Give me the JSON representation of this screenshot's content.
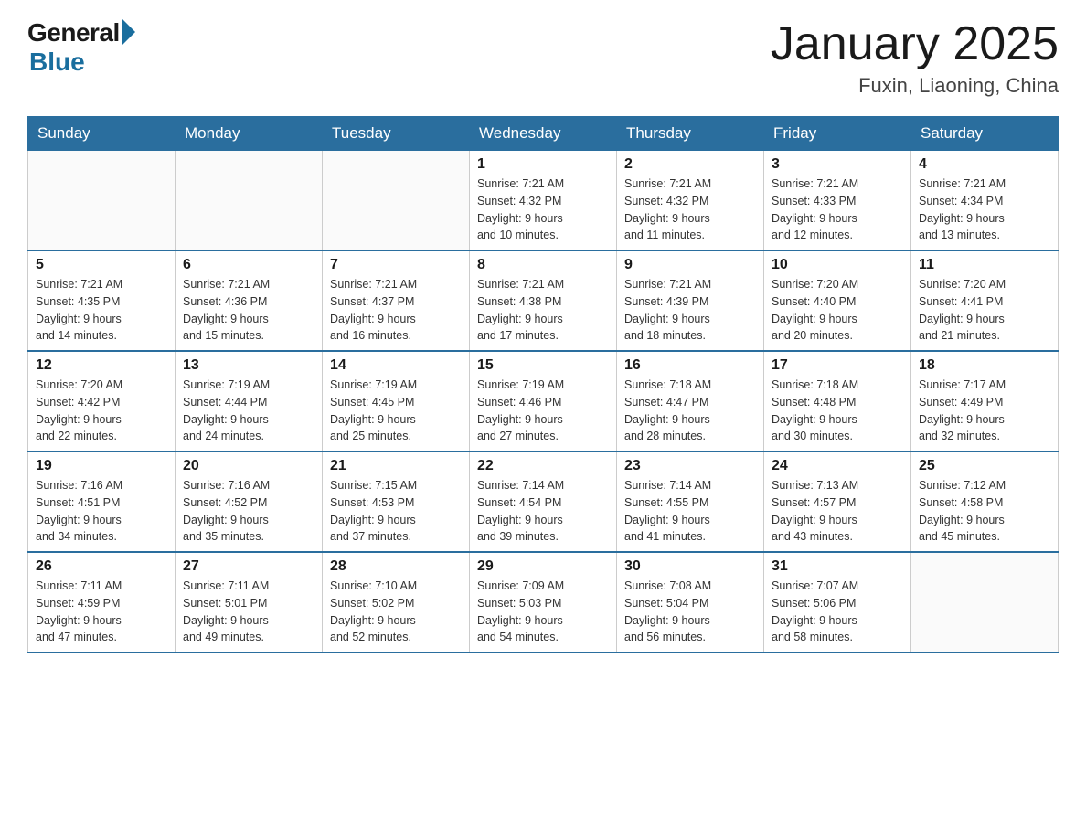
{
  "header": {
    "logo_general": "General",
    "logo_blue": "Blue",
    "title": "January 2025",
    "subtitle": "Fuxin, Liaoning, China"
  },
  "days_of_week": [
    "Sunday",
    "Monday",
    "Tuesday",
    "Wednesday",
    "Thursday",
    "Friday",
    "Saturday"
  ],
  "weeks": [
    [
      {
        "day": "",
        "info": ""
      },
      {
        "day": "",
        "info": ""
      },
      {
        "day": "",
        "info": ""
      },
      {
        "day": "1",
        "info": "Sunrise: 7:21 AM\nSunset: 4:32 PM\nDaylight: 9 hours\nand 10 minutes."
      },
      {
        "day": "2",
        "info": "Sunrise: 7:21 AM\nSunset: 4:32 PM\nDaylight: 9 hours\nand 11 minutes."
      },
      {
        "day": "3",
        "info": "Sunrise: 7:21 AM\nSunset: 4:33 PM\nDaylight: 9 hours\nand 12 minutes."
      },
      {
        "day": "4",
        "info": "Sunrise: 7:21 AM\nSunset: 4:34 PM\nDaylight: 9 hours\nand 13 minutes."
      }
    ],
    [
      {
        "day": "5",
        "info": "Sunrise: 7:21 AM\nSunset: 4:35 PM\nDaylight: 9 hours\nand 14 minutes."
      },
      {
        "day": "6",
        "info": "Sunrise: 7:21 AM\nSunset: 4:36 PM\nDaylight: 9 hours\nand 15 minutes."
      },
      {
        "day": "7",
        "info": "Sunrise: 7:21 AM\nSunset: 4:37 PM\nDaylight: 9 hours\nand 16 minutes."
      },
      {
        "day": "8",
        "info": "Sunrise: 7:21 AM\nSunset: 4:38 PM\nDaylight: 9 hours\nand 17 minutes."
      },
      {
        "day": "9",
        "info": "Sunrise: 7:21 AM\nSunset: 4:39 PM\nDaylight: 9 hours\nand 18 minutes."
      },
      {
        "day": "10",
        "info": "Sunrise: 7:20 AM\nSunset: 4:40 PM\nDaylight: 9 hours\nand 20 minutes."
      },
      {
        "day": "11",
        "info": "Sunrise: 7:20 AM\nSunset: 4:41 PM\nDaylight: 9 hours\nand 21 minutes."
      }
    ],
    [
      {
        "day": "12",
        "info": "Sunrise: 7:20 AM\nSunset: 4:42 PM\nDaylight: 9 hours\nand 22 minutes."
      },
      {
        "day": "13",
        "info": "Sunrise: 7:19 AM\nSunset: 4:44 PM\nDaylight: 9 hours\nand 24 minutes."
      },
      {
        "day": "14",
        "info": "Sunrise: 7:19 AM\nSunset: 4:45 PM\nDaylight: 9 hours\nand 25 minutes."
      },
      {
        "day": "15",
        "info": "Sunrise: 7:19 AM\nSunset: 4:46 PM\nDaylight: 9 hours\nand 27 minutes."
      },
      {
        "day": "16",
        "info": "Sunrise: 7:18 AM\nSunset: 4:47 PM\nDaylight: 9 hours\nand 28 minutes."
      },
      {
        "day": "17",
        "info": "Sunrise: 7:18 AM\nSunset: 4:48 PM\nDaylight: 9 hours\nand 30 minutes."
      },
      {
        "day": "18",
        "info": "Sunrise: 7:17 AM\nSunset: 4:49 PM\nDaylight: 9 hours\nand 32 minutes."
      }
    ],
    [
      {
        "day": "19",
        "info": "Sunrise: 7:16 AM\nSunset: 4:51 PM\nDaylight: 9 hours\nand 34 minutes."
      },
      {
        "day": "20",
        "info": "Sunrise: 7:16 AM\nSunset: 4:52 PM\nDaylight: 9 hours\nand 35 minutes."
      },
      {
        "day": "21",
        "info": "Sunrise: 7:15 AM\nSunset: 4:53 PM\nDaylight: 9 hours\nand 37 minutes."
      },
      {
        "day": "22",
        "info": "Sunrise: 7:14 AM\nSunset: 4:54 PM\nDaylight: 9 hours\nand 39 minutes."
      },
      {
        "day": "23",
        "info": "Sunrise: 7:14 AM\nSunset: 4:55 PM\nDaylight: 9 hours\nand 41 minutes."
      },
      {
        "day": "24",
        "info": "Sunrise: 7:13 AM\nSunset: 4:57 PM\nDaylight: 9 hours\nand 43 minutes."
      },
      {
        "day": "25",
        "info": "Sunrise: 7:12 AM\nSunset: 4:58 PM\nDaylight: 9 hours\nand 45 minutes."
      }
    ],
    [
      {
        "day": "26",
        "info": "Sunrise: 7:11 AM\nSunset: 4:59 PM\nDaylight: 9 hours\nand 47 minutes."
      },
      {
        "day": "27",
        "info": "Sunrise: 7:11 AM\nSunset: 5:01 PM\nDaylight: 9 hours\nand 49 minutes."
      },
      {
        "day": "28",
        "info": "Sunrise: 7:10 AM\nSunset: 5:02 PM\nDaylight: 9 hours\nand 52 minutes."
      },
      {
        "day": "29",
        "info": "Sunrise: 7:09 AM\nSunset: 5:03 PM\nDaylight: 9 hours\nand 54 minutes."
      },
      {
        "day": "30",
        "info": "Sunrise: 7:08 AM\nSunset: 5:04 PM\nDaylight: 9 hours\nand 56 minutes."
      },
      {
        "day": "31",
        "info": "Sunrise: 7:07 AM\nSunset: 5:06 PM\nDaylight: 9 hours\nand 58 minutes."
      },
      {
        "day": "",
        "info": ""
      }
    ]
  ]
}
